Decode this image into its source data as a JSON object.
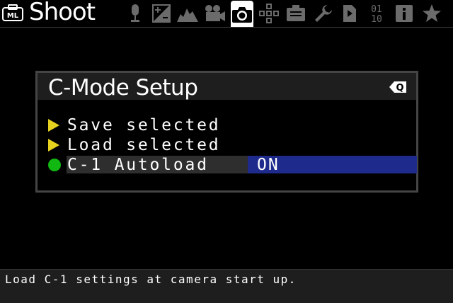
{
  "topbar": {
    "logo_text": "ML",
    "title": "Shoot",
    "tabs": [
      {
        "name": "audio"
      },
      {
        "name": "expo"
      },
      {
        "name": "overlay"
      },
      {
        "name": "movie"
      },
      {
        "name": "shoot",
        "active": true
      },
      {
        "name": "focus"
      },
      {
        "name": "display"
      },
      {
        "name": "prefs"
      },
      {
        "name": "scripts"
      },
      {
        "name": "debug",
        "text": "01\n10"
      },
      {
        "name": "info"
      },
      {
        "name": "favorites"
      }
    ]
  },
  "dialog": {
    "title": "C-Mode Setup",
    "q_label": "Q",
    "items": [
      {
        "label": "Save selected",
        "bullet": "yellow-triangle"
      },
      {
        "label": "Load selected",
        "bullet": "yellow-triangle"
      },
      {
        "label": "C-1 Autoload",
        "value": "ON",
        "bullet": "green-dot",
        "selected": true
      }
    ]
  },
  "status": {
    "help_text": "Load C-1 settings at camera start up."
  },
  "colors": {
    "background": "#000000",
    "selected_value_bg": "#1e2a8c",
    "bullet_yellow": "#e6d21e",
    "bullet_green": "#12b812"
  }
}
